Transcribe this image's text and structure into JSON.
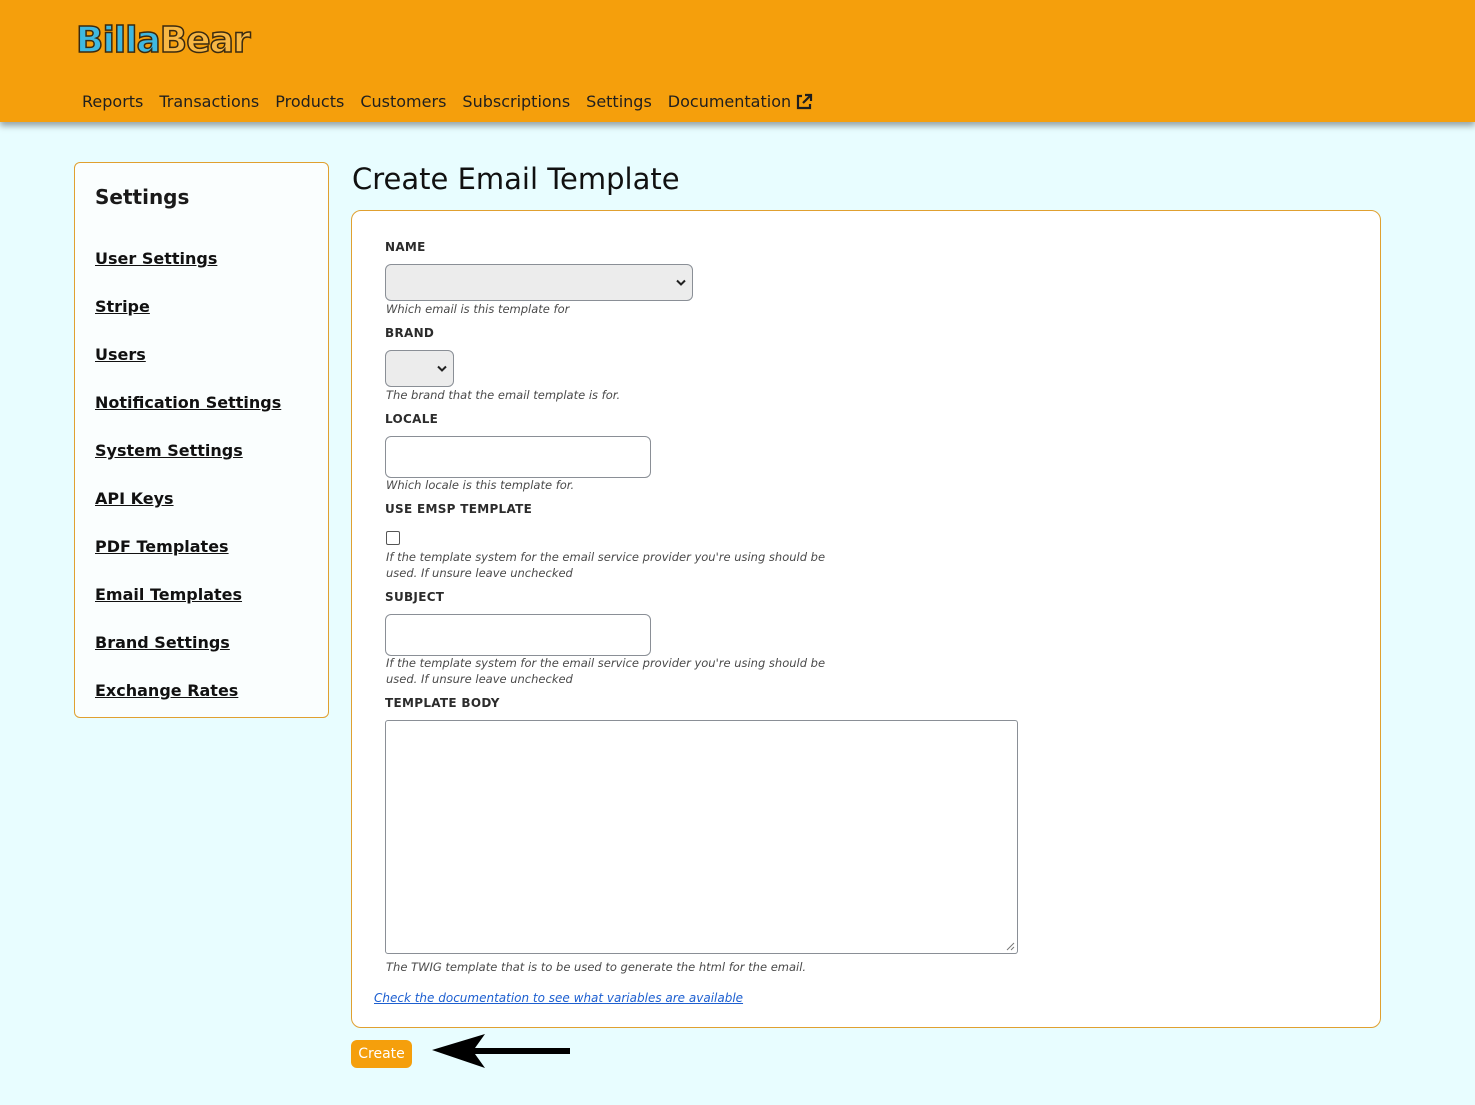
{
  "app": {
    "logo_part1": "Billa",
    "logo_part2": "Bear"
  },
  "nav": {
    "items": [
      "Reports",
      "Transactions",
      "Products",
      "Customers",
      "Subscriptions",
      "Settings",
      "Documentation"
    ],
    "external_icon": "external-link-icon"
  },
  "sidebar": {
    "title": "Settings",
    "items": [
      "User Settings",
      "Stripe",
      "Users",
      "Notification Settings",
      "System Settings",
      "API Keys",
      "PDF Templates",
      "Email Templates",
      "Brand Settings",
      "Exchange Rates"
    ]
  },
  "page": {
    "title": "Create Email Template"
  },
  "form": {
    "name": {
      "label": "NAME",
      "value": "",
      "hint": "Which email is this template for"
    },
    "brand": {
      "label": "BRAND",
      "value": "",
      "hint": "The brand that the email template is for."
    },
    "locale": {
      "label": "LOCALE",
      "value": "",
      "hint": "Which locale is this template for."
    },
    "use_emsp": {
      "label": "USE EMSP TEMPLATE",
      "checked": false,
      "hint": "If the template system for the email service provider you're using should be used. If unsure leave unchecked"
    },
    "subject": {
      "label": "SUBJECT",
      "value": "",
      "hint": "If the template system for the email service provider you're using should be used. If unsure leave unchecked"
    },
    "template_body": {
      "label": "TEMPLATE BODY",
      "value": "",
      "hint": "The TWIG template that is to be used to generate the html for the email."
    },
    "doc_link": "Check the documentation to see what variables are available",
    "submit_label": "Create"
  },
  "colors": {
    "header": "#f59f0c",
    "background": "#e8fdff",
    "border": "#e0a030",
    "link": "#1d5fd0"
  }
}
